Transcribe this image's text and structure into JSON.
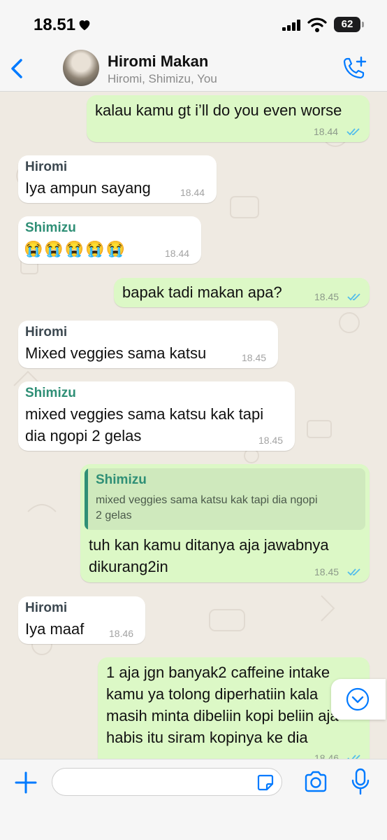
{
  "status_bar": {
    "time": "18.51",
    "battery": "62"
  },
  "header": {
    "title": "Hiromi Makan",
    "subtitle": "Hiromi, Shimizu, You"
  },
  "messages": [
    {
      "direction": "out",
      "text": "kalau kamu gt i’ll do you even worse",
      "time": "18.44",
      "read": true
    },
    {
      "direction": "in",
      "sender": "Hiromi",
      "text": "Iya ampun sayang",
      "time": "18.44"
    },
    {
      "direction": "in",
      "sender": "Shimizu",
      "text": "😭😭😭😭😭",
      "time": "18.44"
    },
    {
      "direction": "out",
      "text": "bapak tadi makan apa?",
      "time": "18.45",
      "read": true
    },
    {
      "direction": "in",
      "sender": "Hiromi",
      "text": "Mixed veggies sama katsu",
      "time": "18.45"
    },
    {
      "direction": "in",
      "sender": "Shimizu",
      "lines": [
        "mixed veggies sama katsu kak tapi",
        "dia ngopi 2 gelas"
      ],
      "time": "18.45"
    },
    {
      "direction": "out",
      "reply_to": {
        "sender": "Shimizu",
        "lines": [
          "mixed veggies sama katsu kak tapi dia ngopi",
          "2 gelas"
        ]
      },
      "lines": [
        "tuh kan kamu ditanya aja jawabnya",
        "dikurang2in"
      ],
      "time": "18.45",
      "read": true
    },
    {
      "direction": "in",
      "sender": "Hiromi",
      "text": "Iya maaf",
      "time": "18.46"
    },
    {
      "direction": "out",
      "lines": [
        "1 aja jgn banyak2 caffeine intake",
        "kamu ya tolong diperhatiin kala",
        "masih minta dibeliin kopi beliin aja",
        "habis itu siram kopinya ke dia"
      ],
      "time": "18.46",
      "read": true
    }
  ],
  "input": {
    "placeholder": ""
  },
  "colors": {
    "accent": "#007aff",
    "outgoing_bubble": "#dcf8c6",
    "incoming_bubble": "#ffffff",
    "shimizu_name": "#2f8f76",
    "read_ticks": "#53bdeb"
  }
}
